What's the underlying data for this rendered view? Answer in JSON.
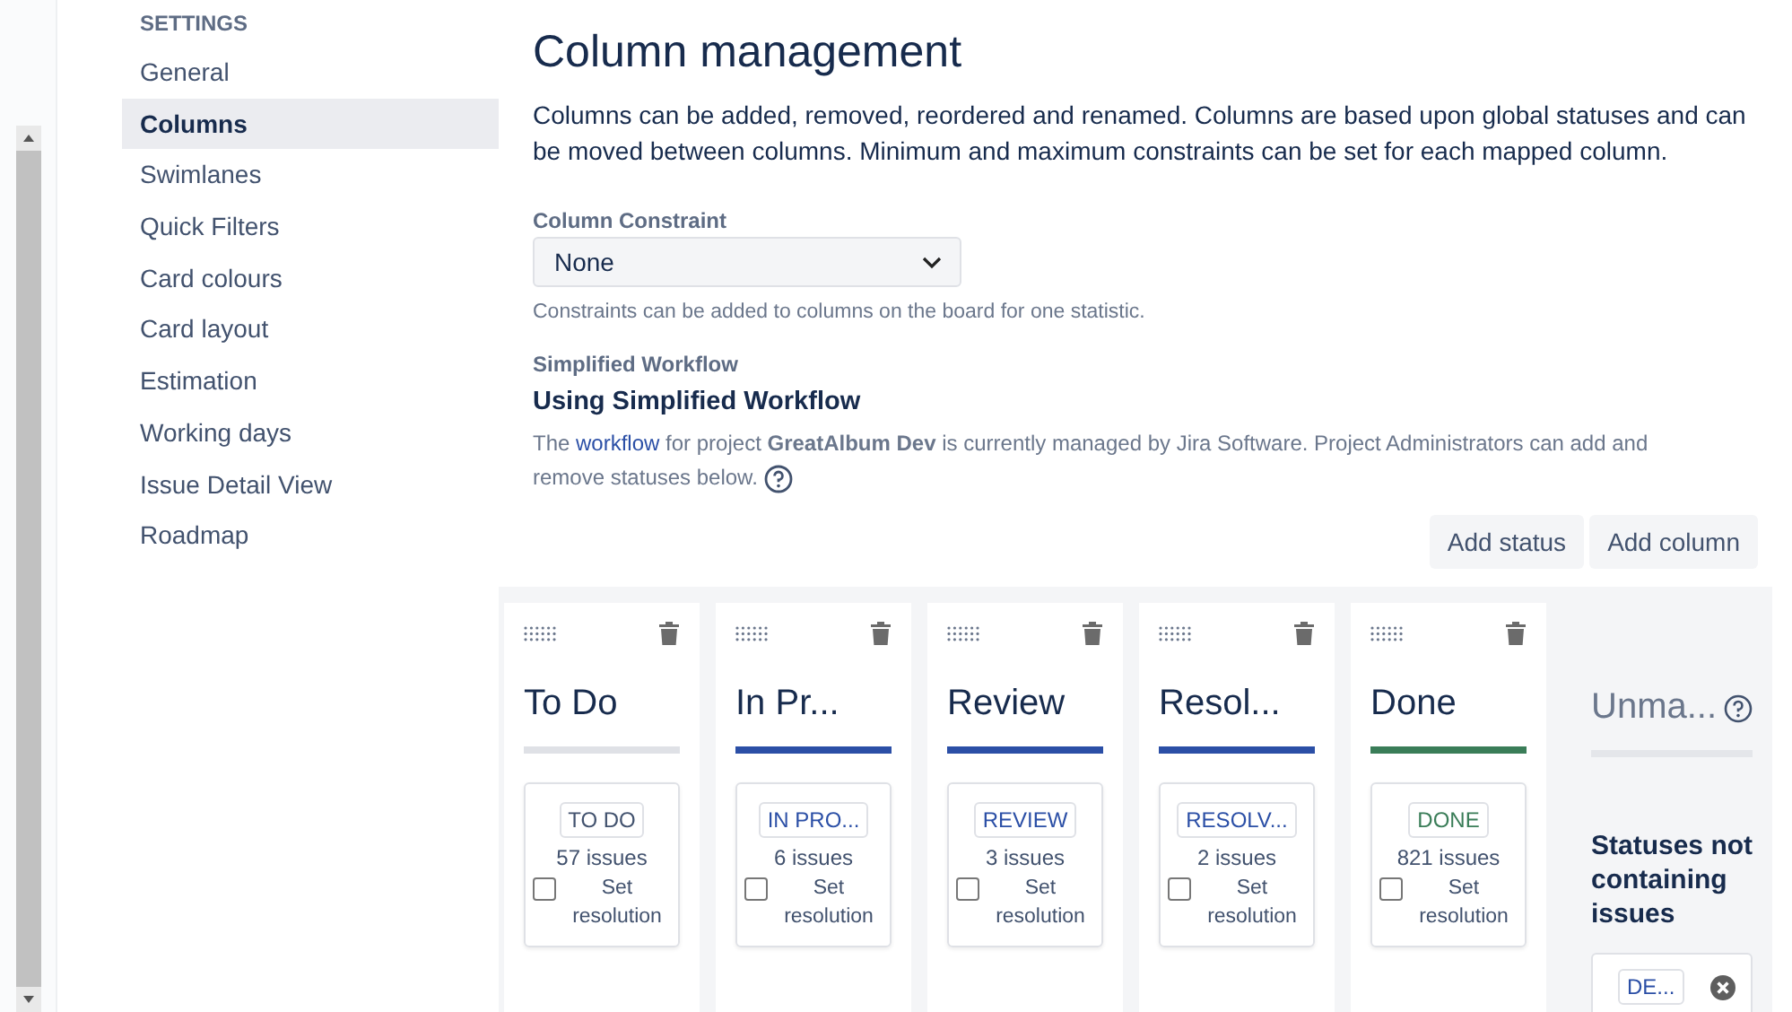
{
  "sidebar": {
    "heading": "SETTINGS",
    "items": [
      {
        "label": "General",
        "selected": false
      },
      {
        "label": "Columns",
        "selected": true
      },
      {
        "label": "Swimlanes",
        "selected": false
      },
      {
        "label": "Quick Filters",
        "selected": false
      },
      {
        "label": "Card colours",
        "selected": false
      },
      {
        "label": "Card layout",
        "selected": false
      },
      {
        "label": "Estimation",
        "selected": false
      },
      {
        "label": "Working days",
        "selected": false
      },
      {
        "label": "Issue Detail View",
        "selected": false
      },
      {
        "label": "Roadmap",
        "selected": false
      }
    ]
  },
  "page": {
    "title": "Column management",
    "description": "Columns can be added, removed, reordered and renamed. Columns are based upon global statuses and can be moved between columns. Minimum and maximum constraints can be set for each mapped column."
  },
  "constraint": {
    "label": "Column Constraint",
    "value": "None",
    "hint": "Constraints can be added to columns on the board for one statistic."
  },
  "workflow": {
    "label": "Simplified Workflow",
    "heading": "Using Simplified Workflow",
    "text_before": "The",
    "link": "workflow",
    "text_after": "for project **GreatAlbum Dev** is currently managed by Jira Software. Project Administrators can add and remove statuses below."
  },
  "buttons": [
    "Add status",
    "Add column"
  ],
  "columns": [
    {
      "title": "To Do",
      "kind": "todo",
      "status": "TO DO",
      "count": "57 issues",
      "checkbox_label": "Set resolution",
      "checked": false
    },
    {
      "title": "In Pr...",
      "kind": "progress",
      "status": "IN PRO...",
      "count": "6 issues",
      "checkbox_label": "Set resolution",
      "checked": false
    },
    {
      "title": "Review",
      "kind": "progress",
      "status": "REVIEW",
      "count": "3 issues",
      "checkbox_label": "Set resolution",
      "checked": false
    },
    {
      "title": "Resol...",
      "kind": "progress",
      "status": "RESOLV...",
      "count": "2 issues",
      "checkbox_label": "Set resolution",
      "checked": false
    },
    {
      "title": "Done",
      "kind": "done",
      "status": "DONE",
      "count": "821 issues",
      "checkbox_label": "Set resolution",
      "checked": false
    }
  ],
  "unmapped": {
    "title": "Unma...",
    "text": "Statuses not containing issues",
    "status": "DE..."
  }
}
